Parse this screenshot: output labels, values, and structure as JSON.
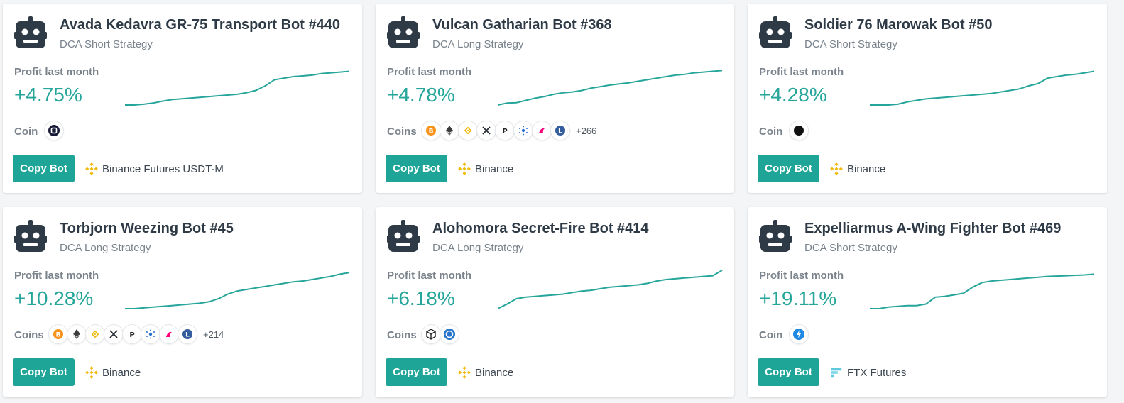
{
  "colors": {
    "accent": "#1fa597",
    "profit": "#26a69a",
    "binance": "#f0b90b",
    "ftx": "#5fcade"
  },
  "copy_label": "Copy Bot",
  "profit_label": "Profit last month",
  "cards": [
    {
      "title": "Avada Kedavra GR-75 Transport Bot #440",
      "strategy": "DCA Short Strategy",
      "profit": "+4.75%",
      "coins_label": "Coin",
      "coins": [
        "wave-coin-icon"
      ],
      "more": "",
      "exchange": "Binance Futures USDT-M",
      "exchange_icon": "binance-icon",
      "spark": [
        0,
        0,
        0.02,
        0.05,
        0.1,
        0.14,
        0.16,
        0.18,
        0.2,
        0.22,
        0.24,
        0.26,
        0.28,
        0.32,
        0.38,
        0.5,
        0.66,
        0.7,
        0.74,
        0.76,
        0.78,
        0.82,
        0.84,
        0.86,
        0.88
      ]
    },
    {
      "title": "Vulcan Gatharian Bot #368",
      "strategy": "DCA Long Strategy",
      "profit": "+4.78%",
      "coins_label": "Coins",
      "coins": [
        "bitcoin-icon",
        "ethereum-icon",
        "bnb-icon",
        "xrp-icon",
        "polkadot-icon",
        "cardano-icon",
        "uniswap-icon",
        "litecoin-icon"
      ],
      "more": "+266",
      "exchange": "Binance",
      "exchange_icon": "binance-icon",
      "spark": [
        0,
        0.05,
        0.06,
        0.12,
        0.18,
        0.22,
        0.28,
        0.32,
        0.34,
        0.38,
        0.44,
        0.48,
        0.52,
        0.55,
        0.58,
        0.62,
        0.66,
        0.7,
        0.74,
        0.78,
        0.8,
        0.84,
        0.86,
        0.88,
        0.9
      ]
    },
    {
      "title": "Soldier 76 Marowak Bot #50",
      "strategy": "DCA Short Strategy",
      "profit": "+4.28%",
      "coins_label": "Coin",
      "coins": [
        "dark-coin-icon"
      ],
      "more": "",
      "exchange": "Binance",
      "exchange_icon": "binance-icon",
      "spark": [
        0,
        0,
        0,
        0.02,
        0.08,
        0.12,
        0.16,
        0.18,
        0.2,
        0.22,
        0.24,
        0.26,
        0.28,
        0.3,
        0.34,
        0.38,
        0.42,
        0.5,
        0.56,
        0.7,
        0.74,
        0.78,
        0.8,
        0.84,
        0.88
      ]
    },
    {
      "title": "Torbjorn Weezing Bot #45",
      "strategy": "DCA Long Strategy",
      "profit": "+10.28%",
      "coins_label": "Coins",
      "coins": [
        "bitcoin-icon",
        "ethereum-icon",
        "bnb-icon",
        "xrp-icon",
        "polkadot-icon",
        "cardano-icon",
        "uniswap-icon",
        "litecoin-icon"
      ],
      "more": "+214",
      "exchange": "Binance",
      "exchange_icon": "binance-icon",
      "spark": [
        0,
        0,
        0.02,
        0.04,
        0.06,
        0.08,
        0.1,
        0.12,
        0.14,
        0.18,
        0.26,
        0.38,
        0.46,
        0.5,
        0.54,
        0.58,
        0.62,
        0.66,
        0.7,
        0.72,
        0.76,
        0.8,
        0.84,
        0.9,
        0.94
      ]
    },
    {
      "title": "Alohomora Secret-Fire Bot #414",
      "strategy": "DCA Long Strategy",
      "profit": "+6.18%",
      "coins_label": "Coins",
      "coins": [
        "cube-coin-icon",
        "circle-coin-icon"
      ],
      "more": "",
      "exchange": "Binance",
      "exchange_icon": "binance-icon",
      "spark": [
        0,
        0.12,
        0.26,
        0.3,
        0.32,
        0.34,
        0.36,
        0.38,
        0.42,
        0.46,
        0.48,
        0.52,
        0.56,
        0.58,
        0.6,
        0.62,
        0.66,
        0.72,
        0.76,
        0.78,
        0.8,
        0.82,
        0.84,
        0.86,
        1.0
      ]
    },
    {
      "title": "Expelliarmus A-Wing Fighter Bot #469",
      "strategy": "DCA Short Strategy",
      "profit": "+19.11%",
      "coins_label": "Coin",
      "coins": [
        "bolt-coin-icon"
      ],
      "more": "",
      "exchange": "FTX Futures",
      "exchange_icon": "ftx-icon",
      "spark": [
        0,
        0,
        0.04,
        0.06,
        0.08,
        0.08,
        0.12,
        0.3,
        0.32,
        0.36,
        0.4,
        0.56,
        0.68,
        0.72,
        0.74,
        0.76,
        0.78,
        0.8,
        0.82,
        0.84,
        0.85,
        0.86,
        0.87,
        0.88,
        0.9
      ]
    }
  ]
}
